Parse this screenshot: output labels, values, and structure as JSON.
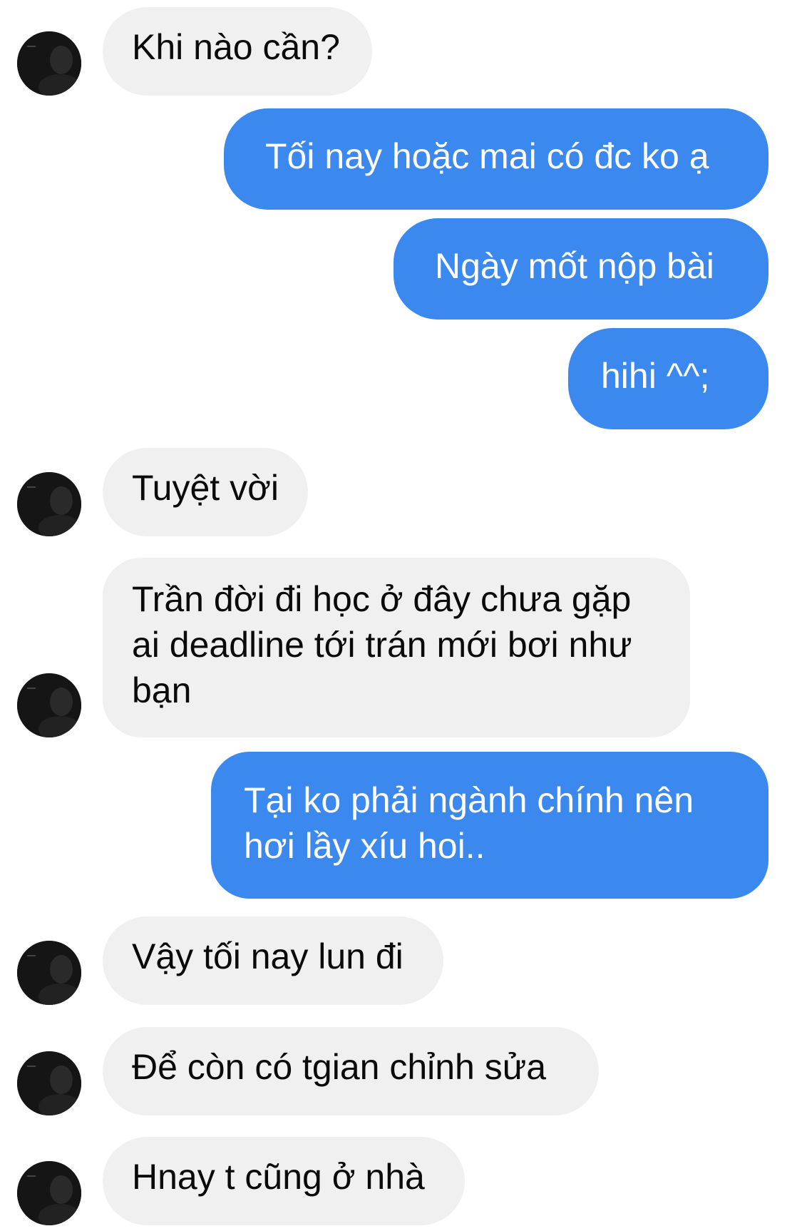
{
  "conversation": {
    "messages": [
      {
        "sender": "other",
        "text": "Khi nào cần?"
      },
      {
        "sender": "me",
        "text": "Tối nay hoặc mai có đc ko ạ"
      },
      {
        "sender": "me",
        "text": "Ngày mốt nộp bài"
      },
      {
        "sender": "me",
        "text": "hihi ^^;"
      },
      {
        "sender": "other",
        "text": "Tuyệt vời"
      },
      {
        "sender": "other",
        "text": "Trần đời đi học ở đây chưa gặp ai deadline tới trán mới bơi như bạn"
      },
      {
        "sender": "me",
        "text": "Tại ko phải ngành chính nên hơi lầy xíu hoi.."
      },
      {
        "sender": "other",
        "text": "Vậy tối nay lun đi"
      },
      {
        "sender": "other",
        "text": "Để còn có tgian chỉnh sửa"
      },
      {
        "sender": "other",
        "text": "Hnay t cũng ở nhà"
      }
    ]
  },
  "colors": {
    "incoming_bubble": "#f0f0f0",
    "outgoing_bubble": "#3b88ef",
    "incoming_text": "#0a0a0a",
    "outgoing_text": "#ffffff"
  },
  "icons": {
    "avatar": "contact-avatar-photo"
  }
}
